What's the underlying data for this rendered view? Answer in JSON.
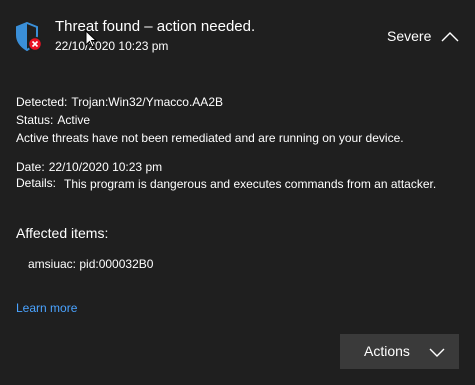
{
  "header": {
    "title": "Threat found – action needed.",
    "timestamp": "22/10/2020 10:23 pm",
    "severity": "Severe",
    "icon": "shield-error-icon"
  },
  "detection": {
    "detected_label": "Detected:",
    "detected_value": "Trojan:Win32/Ymacco.AA2B",
    "status_label": "Status:",
    "status_value": "Active",
    "status_message": "Active threats have not been remediated and are running on your device.",
    "date_label": "Date:",
    "date_value": "22/10/2020 10:23 pm",
    "details_label": "Details:",
    "details_value": "This program is dangerous and executes commands from an attacker."
  },
  "affected": {
    "heading": "Affected items:",
    "items": [
      "amsiuac: pid:000032B0"
    ]
  },
  "links": {
    "learn_more": "Learn more"
  },
  "actions": {
    "label": "Actions"
  },
  "colors": {
    "background": "#1f1f1f",
    "link": "#4aa3ff",
    "button": "#3a3a3a",
    "shield": "#3a8fd8",
    "error": "#e81123"
  }
}
